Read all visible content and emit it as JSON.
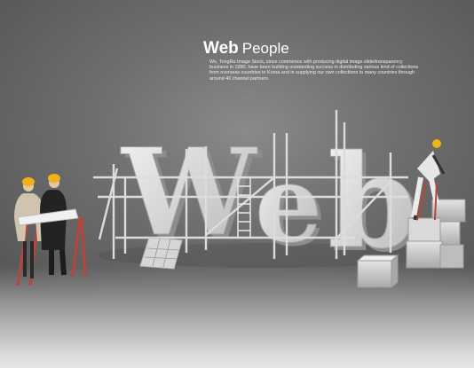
{
  "headline": {
    "bold": "Web",
    "regular": "People"
  },
  "blurb": "We, TongRo Image Stock, since commence with producing digital image slide/transparency business in 1990, have been building outstanding success in distributing various kind of collections from overseas countries to Korea and in supplying our own collections to many countries through around 40 channel partners.",
  "sign": {
    "letters": [
      "W",
      "e",
      "b"
    ]
  },
  "colors": {
    "letter": "#cfcfcf",
    "scaffold": "#d9d9d9",
    "boxes": "#c8c8c8",
    "ladder": "#b8453a",
    "helmet": "#f2b21a"
  }
}
